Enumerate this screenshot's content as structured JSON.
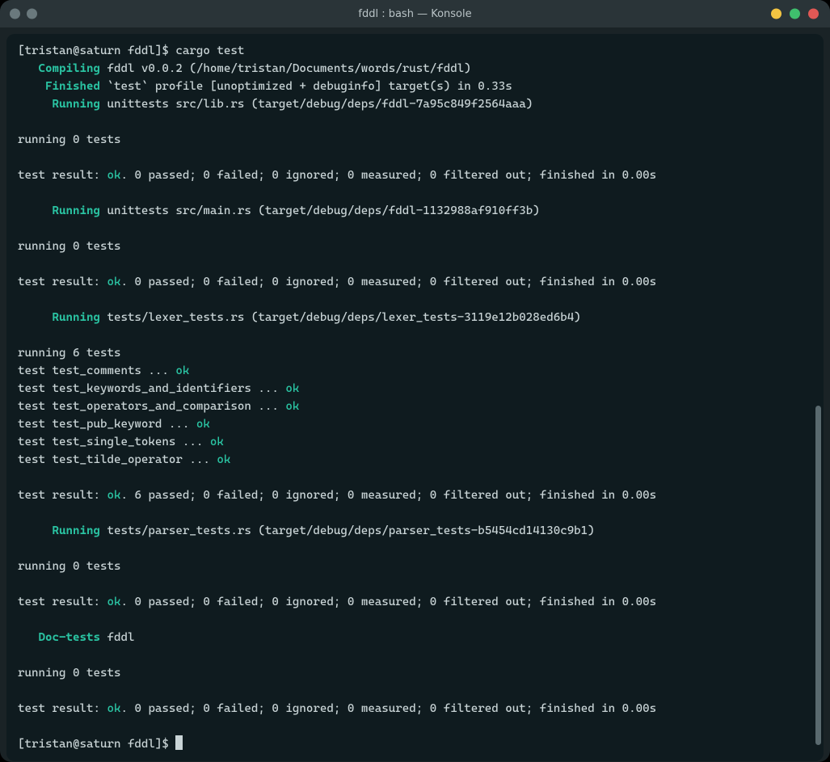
{
  "window": {
    "title": "fddl : bash — Konsole"
  },
  "prompt1": {
    "text": "[tristan@saturn fddl]$ ",
    "cmd": "cargo test"
  },
  "compiling": {
    "label": "   Compiling",
    "rest": " fddl v0.0.2 (/home/tristan/Documents/words/rust/fddl)"
  },
  "finished": {
    "label": "    Finished",
    "rest": " `test` profile [unoptimized + debuginfo] target(s) in 0.33s"
  },
  "run1": {
    "label": "     Running",
    "rest": " unittests src/lib.rs (target/debug/deps/fddl-7a95c849f2564aaa)"
  },
  "block1": {
    "running": "running 0 tests",
    "result_pre": "test result: ",
    "ok": "ok",
    "result_post": ". 0 passed; 0 failed; 0 ignored; 0 measured; 0 filtered out; finished in 0.00s"
  },
  "run2": {
    "label": "     Running",
    "rest": " unittests src/main.rs (target/debug/deps/fddl-1132988af910ff3b)"
  },
  "block2": {
    "running": "running 0 tests",
    "result_pre": "test result: ",
    "ok": "ok",
    "result_post": ". 0 passed; 0 failed; 0 ignored; 0 measured; 0 filtered out; finished in 0.00s"
  },
  "run3": {
    "label": "     Running",
    "rest": " tests/lexer_tests.rs (target/debug/deps/lexer_tests-3119e12b028ed6b4)"
  },
  "block3": {
    "running": "running 6 tests",
    "tests": [
      {
        "name": "test test_comments ... ",
        "ok": "ok"
      },
      {
        "name": "test test_keywords_and_identifiers ... ",
        "ok": "ok"
      },
      {
        "name": "test test_operators_and_comparison ... ",
        "ok": "ok"
      },
      {
        "name": "test test_pub_keyword ... ",
        "ok": "ok"
      },
      {
        "name": "test test_single_tokens ... ",
        "ok": "ok"
      },
      {
        "name": "test test_tilde_operator ... ",
        "ok": "ok"
      }
    ],
    "result_pre": "test result: ",
    "ok": "ok",
    "result_post": ". 6 passed; 0 failed; 0 ignored; 0 measured; 0 filtered out; finished in 0.00s"
  },
  "run4": {
    "label": "     Running",
    "rest": " tests/parser_tests.rs (target/debug/deps/parser_tests-b5454cd14130c9b1)"
  },
  "block4": {
    "running": "running 0 tests",
    "result_pre": "test result: ",
    "ok": "ok",
    "result_post": ". 0 passed; 0 failed; 0 ignored; 0 measured; 0 filtered out; finished in 0.00s"
  },
  "doctests": {
    "label": "   Doc-tests",
    "rest": " fddl"
  },
  "block5": {
    "running": "running 0 tests",
    "result_pre": "test result: ",
    "ok": "ok",
    "result_post": ". 0 passed; 0 failed; 0 ignored; 0 measured; 0 filtered out; finished in 0.00s"
  },
  "prompt2": {
    "text": "[tristan@saturn fddl]$ "
  }
}
